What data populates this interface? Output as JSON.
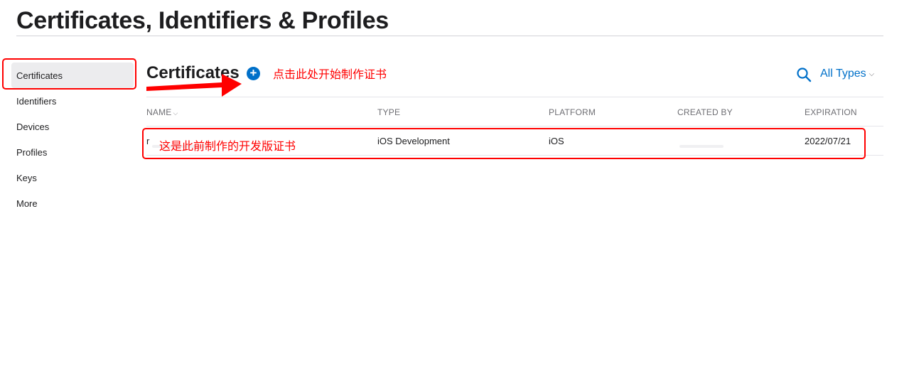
{
  "page": {
    "title": "Certificates, Identifiers & Profiles"
  },
  "sidebar": {
    "items": [
      {
        "label": "Certificates",
        "active": true
      },
      {
        "label": "Identifiers"
      },
      {
        "label": "Devices"
      },
      {
        "label": "Profiles"
      },
      {
        "label": "Keys"
      },
      {
        "label": "More"
      }
    ]
  },
  "section": {
    "title": "Certificates",
    "add_glyph": "+",
    "filter_label": "All Types",
    "filter_chevron": "⌵"
  },
  "annotations": {
    "start_hint": "点击此处开始制作证书",
    "row_hint": "这是此前制作的开发版证书",
    "color": "#ff0000"
  },
  "table": {
    "columns": [
      "NAME",
      "TYPE",
      "PLATFORM",
      "CREATED BY",
      "EXPIRATION"
    ],
    "sort_glyph": "⌵",
    "rows": [
      {
        "name": "r",
        "type": "iOS Development",
        "platform": "iOS",
        "created_by": "",
        "expiration": "2022/07/21"
      }
    ]
  },
  "icons": {
    "search": "search-icon",
    "add": "plus-circle-icon",
    "chevron": "chevron-down-icon"
  },
  "colors": {
    "accent": "#0070c9",
    "annotation": "#ff0000",
    "active_bg": "#ececee"
  }
}
